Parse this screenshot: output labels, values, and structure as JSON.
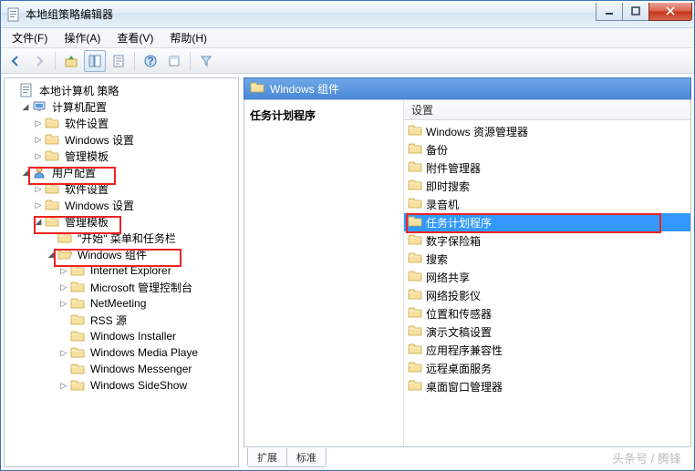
{
  "title": "本地组策略编辑器",
  "menu": [
    "文件(F)",
    "操作(A)",
    "查看(V)",
    "帮助(H)"
  ],
  "tree": {
    "root": "本地计算机 策略",
    "computer": {
      "label": "计算机配置",
      "items": [
        "软件设置",
        "Windows 设置",
        "管理模板"
      ]
    },
    "user": {
      "label": "用户配置",
      "soft": "软件设置",
      "win": "Windows 设置",
      "admin": "管理模板",
      "start": "\"开始\" 菜单和任务栏",
      "wincomp": "Windows 组件",
      "sub": [
        "Internet Explorer",
        "Microsoft 管理控制台",
        "NetMeeting",
        "RSS 源",
        "Windows Installer",
        "Windows Media Playe",
        "Windows Messenger",
        "Windows SideShow"
      ]
    }
  },
  "right": {
    "header": "Windows 组件",
    "detail_title": "任务计划程序",
    "column": "设置",
    "items": [
      "Windows 资源管理器",
      "备份",
      "附件管理器",
      "即时搜索",
      "录音机",
      "任务计划程序",
      "数字保险箱",
      "搜索",
      "网络共享",
      "网络投影仪",
      "位置和传感器",
      "演示文稿设置",
      "应用程序兼容性",
      "远程桌面服务",
      "桌面窗口管理器"
    ],
    "selected_index": 5
  },
  "tabs": [
    "扩展",
    "标准"
  ],
  "watermark": "头条号 / 腾锋"
}
